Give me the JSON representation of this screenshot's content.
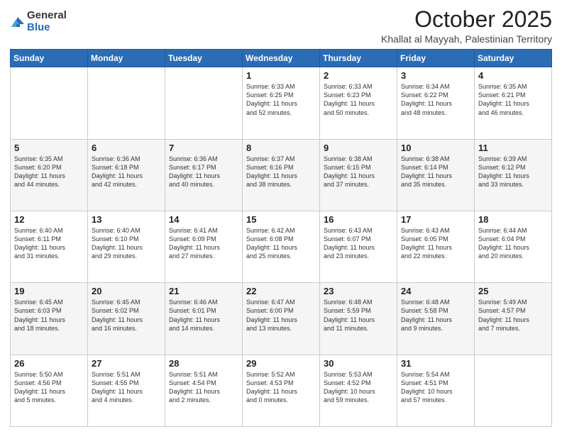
{
  "logo": {
    "general": "General",
    "blue": "Blue"
  },
  "title": "October 2025",
  "location": "Khallat al Mayyah, Palestinian Territory",
  "days_of_week": [
    "Sunday",
    "Monday",
    "Tuesday",
    "Wednesday",
    "Thursday",
    "Friday",
    "Saturday"
  ],
  "weeks": [
    [
      {
        "day": "",
        "info": ""
      },
      {
        "day": "",
        "info": ""
      },
      {
        "day": "",
        "info": ""
      },
      {
        "day": "1",
        "info": "Sunrise: 6:33 AM\nSunset: 6:25 PM\nDaylight: 11 hours\nand 52 minutes."
      },
      {
        "day": "2",
        "info": "Sunrise: 6:33 AM\nSunset: 6:23 PM\nDaylight: 11 hours\nand 50 minutes."
      },
      {
        "day": "3",
        "info": "Sunrise: 6:34 AM\nSunset: 6:22 PM\nDaylight: 11 hours\nand 48 minutes."
      },
      {
        "day": "4",
        "info": "Sunrise: 6:35 AM\nSunset: 6:21 PM\nDaylight: 11 hours\nand 46 minutes."
      }
    ],
    [
      {
        "day": "5",
        "info": "Sunrise: 6:35 AM\nSunset: 6:20 PM\nDaylight: 11 hours\nand 44 minutes."
      },
      {
        "day": "6",
        "info": "Sunrise: 6:36 AM\nSunset: 6:18 PM\nDaylight: 11 hours\nand 42 minutes."
      },
      {
        "day": "7",
        "info": "Sunrise: 6:36 AM\nSunset: 6:17 PM\nDaylight: 11 hours\nand 40 minutes."
      },
      {
        "day": "8",
        "info": "Sunrise: 6:37 AM\nSunset: 6:16 PM\nDaylight: 11 hours\nand 38 minutes."
      },
      {
        "day": "9",
        "info": "Sunrise: 6:38 AM\nSunset: 6:15 PM\nDaylight: 11 hours\nand 37 minutes."
      },
      {
        "day": "10",
        "info": "Sunrise: 6:38 AM\nSunset: 6:14 PM\nDaylight: 11 hours\nand 35 minutes."
      },
      {
        "day": "11",
        "info": "Sunrise: 6:39 AM\nSunset: 6:12 PM\nDaylight: 11 hours\nand 33 minutes."
      }
    ],
    [
      {
        "day": "12",
        "info": "Sunrise: 6:40 AM\nSunset: 6:11 PM\nDaylight: 11 hours\nand 31 minutes."
      },
      {
        "day": "13",
        "info": "Sunrise: 6:40 AM\nSunset: 6:10 PM\nDaylight: 11 hours\nand 29 minutes."
      },
      {
        "day": "14",
        "info": "Sunrise: 6:41 AM\nSunset: 6:09 PM\nDaylight: 11 hours\nand 27 minutes."
      },
      {
        "day": "15",
        "info": "Sunrise: 6:42 AM\nSunset: 6:08 PM\nDaylight: 11 hours\nand 25 minutes."
      },
      {
        "day": "16",
        "info": "Sunrise: 6:43 AM\nSunset: 6:07 PM\nDaylight: 11 hours\nand 23 minutes."
      },
      {
        "day": "17",
        "info": "Sunrise: 6:43 AM\nSunset: 6:05 PM\nDaylight: 11 hours\nand 22 minutes."
      },
      {
        "day": "18",
        "info": "Sunrise: 6:44 AM\nSunset: 6:04 PM\nDaylight: 11 hours\nand 20 minutes."
      }
    ],
    [
      {
        "day": "19",
        "info": "Sunrise: 6:45 AM\nSunset: 6:03 PM\nDaylight: 11 hours\nand 18 minutes."
      },
      {
        "day": "20",
        "info": "Sunrise: 6:45 AM\nSunset: 6:02 PM\nDaylight: 11 hours\nand 16 minutes."
      },
      {
        "day": "21",
        "info": "Sunrise: 6:46 AM\nSunset: 6:01 PM\nDaylight: 11 hours\nand 14 minutes."
      },
      {
        "day": "22",
        "info": "Sunrise: 6:47 AM\nSunset: 6:00 PM\nDaylight: 11 hours\nand 13 minutes."
      },
      {
        "day": "23",
        "info": "Sunrise: 6:48 AM\nSunset: 5:59 PM\nDaylight: 11 hours\nand 11 minutes."
      },
      {
        "day": "24",
        "info": "Sunrise: 6:48 AM\nSunset: 5:58 PM\nDaylight: 11 hours\nand 9 minutes."
      },
      {
        "day": "25",
        "info": "Sunrise: 5:49 AM\nSunset: 4:57 PM\nDaylight: 11 hours\nand 7 minutes."
      }
    ],
    [
      {
        "day": "26",
        "info": "Sunrise: 5:50 AM\nSunset: 4:56 PM\nDaylight: 11 hours\nand 5 minutes."
      },
      {
        "day": "27",
        "info": "Sunrise: 5:51 AM\nSunset: 4:55 PM\nDaylight: 11 hours\nand 4 minutes."
      },
      {
        "day": "28",
        "info": "Sunrise: 5:51 AM\nSunset: 4:54 PM\nDaylight: 11 hours\nand 2 minutes."
      },
      {
        "day": "29",
        "info": "Sunrise: 5:52 AM\nSunset: 4:53 PM\nDaylight: 11 hours\nand 0 minutes."
      },
      {
        "day": "30",
        "info": "Sunrise: 5:53 AM\nSunset: 4:52 PM\nDaylight: 10 hours\nand 59 minutes."
      },
      {
        "day": "31",
        "info": "Sunrise: 5:54 AM\nSunset: 4:51 PM\nDaylight: 10 hours\nand 57 minutes."
      },
      {
        "day": "",
        "info": ""
      }
    ]
  ]
}
